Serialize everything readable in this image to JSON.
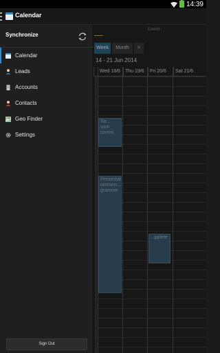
{
  "status_bar": {
    "time": "14:39"
  },
  "action_bar": {
    "title": "Calendar"
  },
  "drawer": {
    "sync_label": "Synchronize",
    "items": [
      {
        "label": "Calendar",
        "icon": "calendar-icon",
        "active": true
      },
      {
        "label": "Leads",
        "icon": "person-icon"
      },
      {
        "label": "Accounts",
        "icon": "building-icon"
      },
      {
        "label": "Contacts",
        "icon": "contact-icon"
      },
      {
        "label": "Geo Finder",
        "icon": "map-icon"
      },
      {
        "label": "Settings",
        "icon": "gear-icon"
      }
    ],
    "sign_out": "Sign Out"
  },
  "calendar": {
    "tab_events": "Events",
    "views": {
      "week": "Week",
      "month": "Month",
      "next": ">"
    },
    "range": "14 - 21 Jun 2014",
    "days": [
      "Wed 18/6",
      "Thu 19/6",
      "Fri 20/6",
      "Sat 21/6"
    ],
    "events": [
      {
        "text": "Sa... sum contro"
      },
      {
        "text": "Presentati... ommerc... gramme"
      },
      {
        "text": "...pplete"
      }
    ]
  },
  "colors": {
    "accent": "#2e8ccf",
    "event": "#3d5f74",
    "active_view": "#2f6a86"
  }
}
